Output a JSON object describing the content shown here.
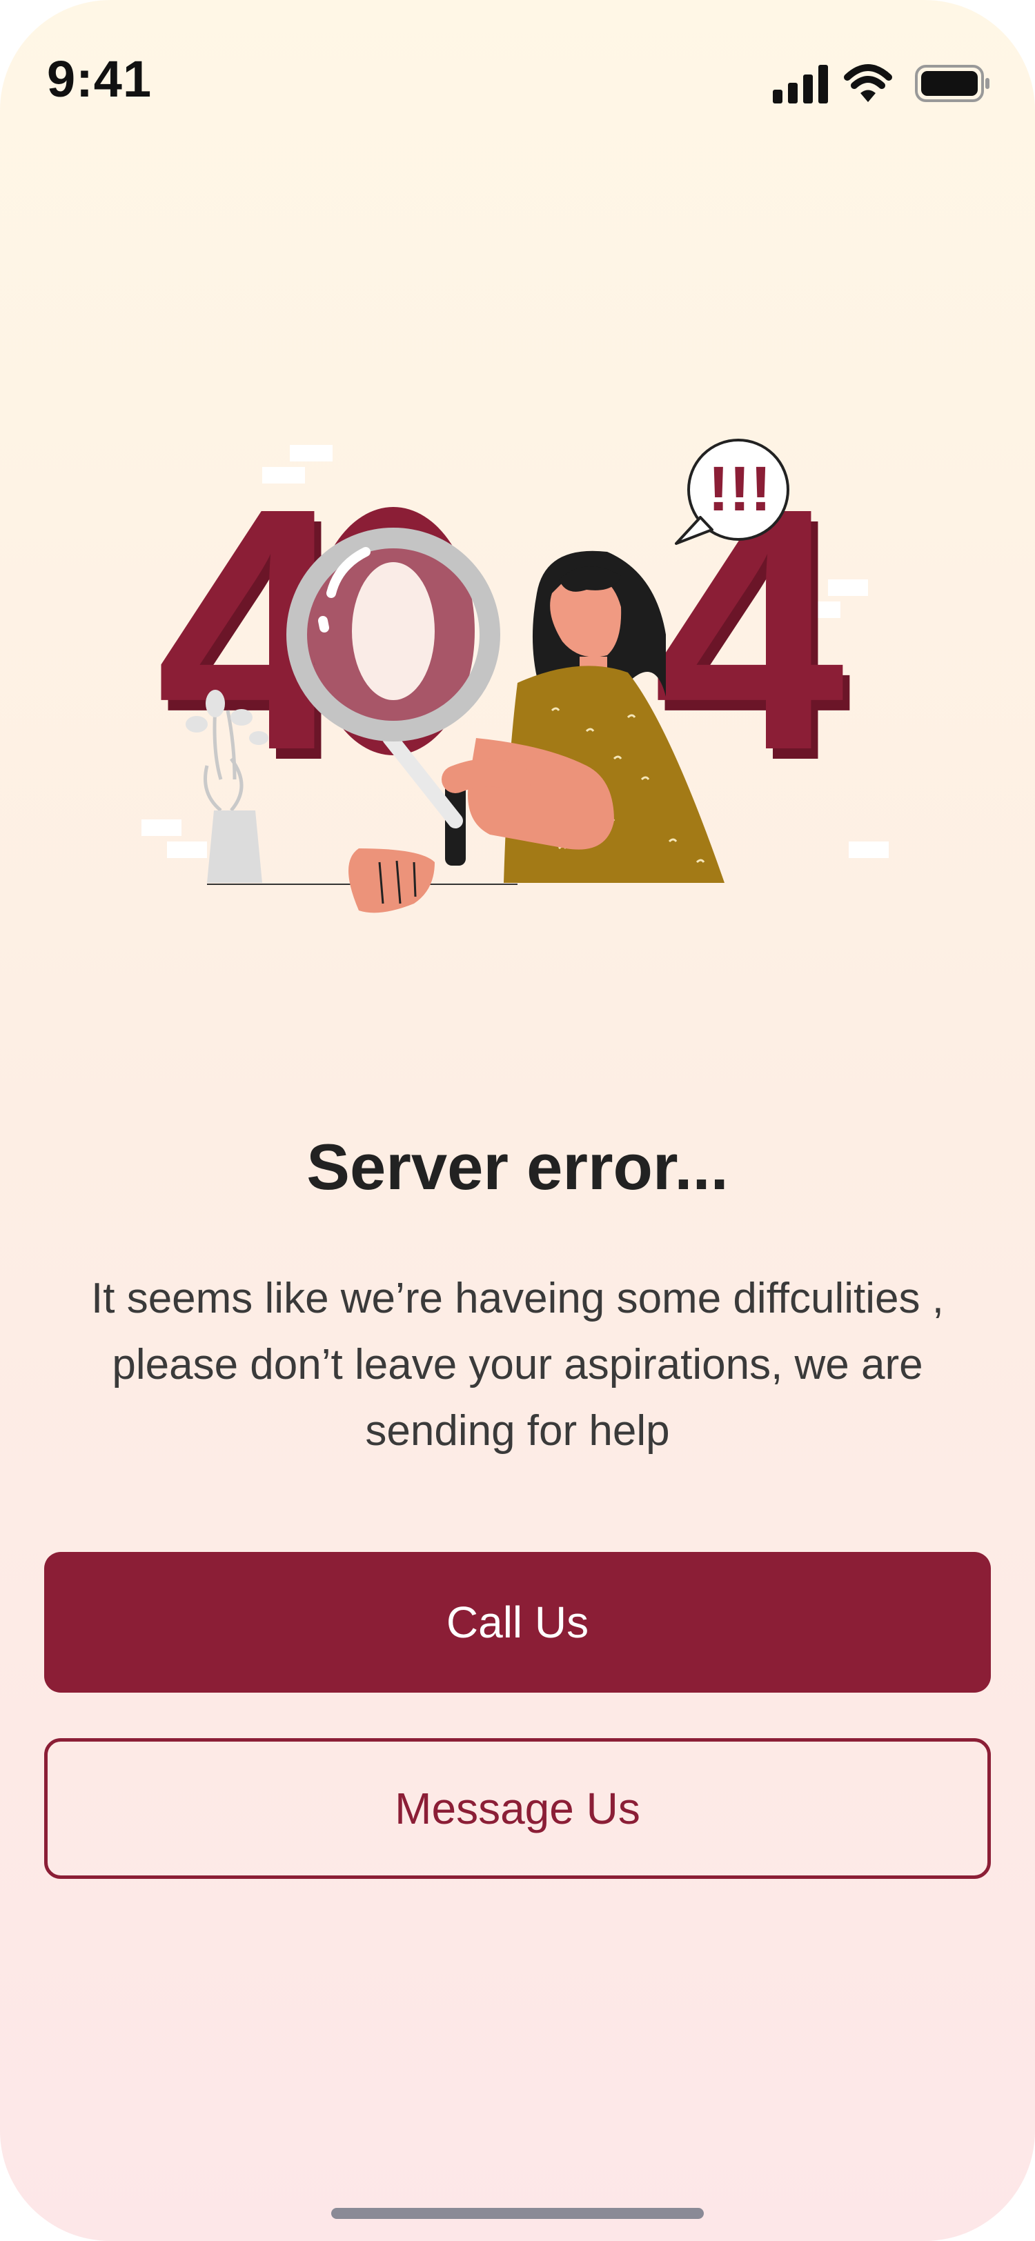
{
  "status_bar": {
    "time": "9:41"
  },
  "illustration": {
    "digits": [
      "4",
      "0",
      "4"
    ],
    "speech_bubble": "!!!"
  },
  "error": {
    "title": "Server error...",
    "message": "It seems like we’re haveing some diffculities , please don’t leave your aspirations, we are sending for help"
  },
  "actions": {
    "call_label": "Call Us",
    "message_label": "Message Us"
  },
  "colors": {
    "accent": "#8b1e36",
    "background_top": "#fff7e6",
    "background_bottom": "#fde7e8",
    "shirt": "#a37a16",
    "skin": "#ec937a"
  }
}
